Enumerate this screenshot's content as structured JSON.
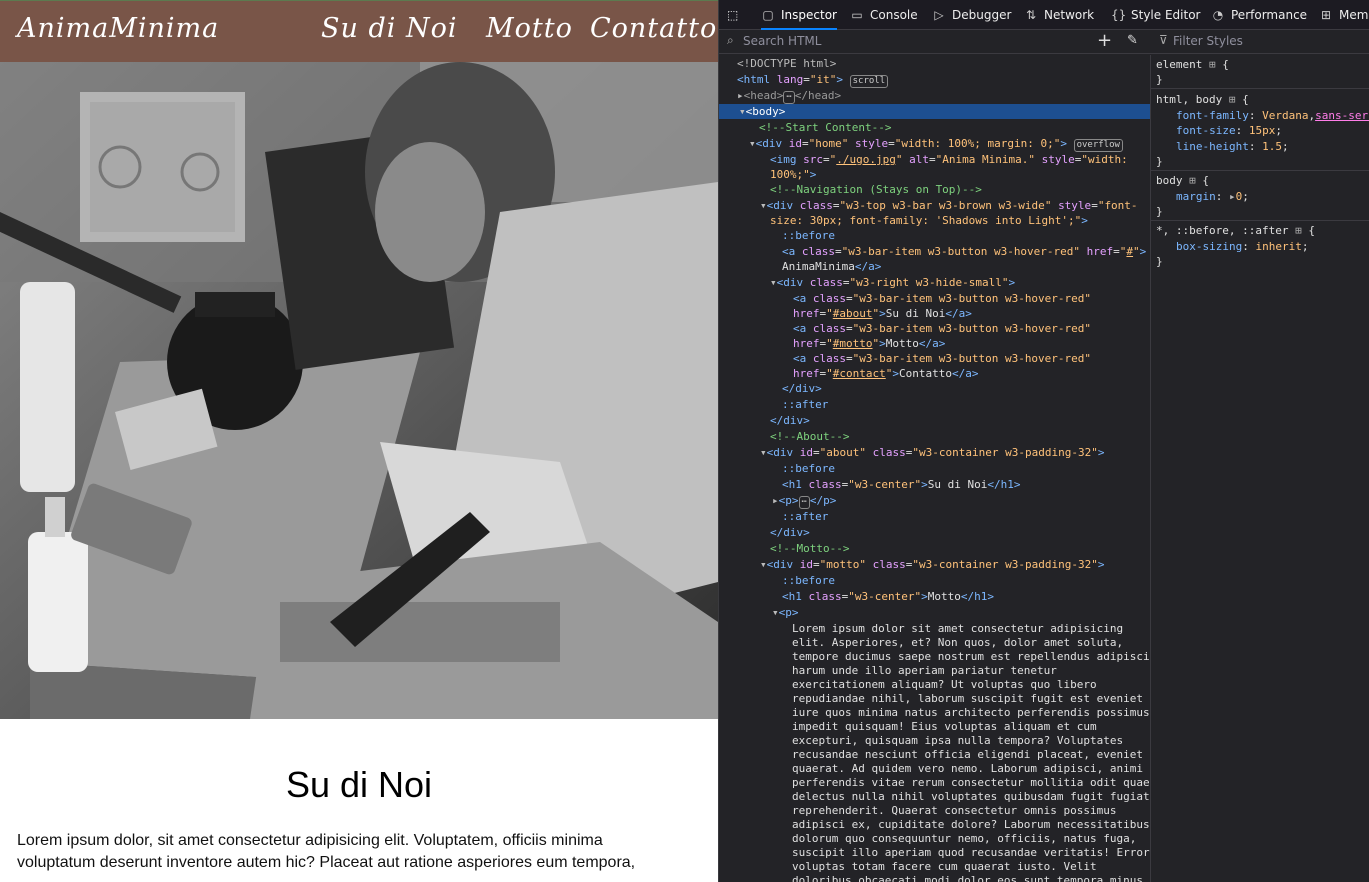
{
  "site": {
    "nav": {
      "brand": "AnimaMinima",
      "items": [
        "Su di Noi",
        "Motto",
        "Contatto"
      ]
    },
    "hero_alt": "Anima Minima.",
    "about": {
      "title": "Su di Noi",
      "text_line1": "Lorem ipsum dolor, sit amet consectetur adipisicing elit. Voluptatem, officiis minima",
      "text_line2": "voluptatum deserunt inventore autem hic? Placeat aut ratione asperiores eum tempora,"
    }
  },
  "devtools": {
    "tabs": [
      {
        "label": "Inspector",
        "icon": "inspector-icon"
      },
      {
        "label": "Console",
        "icon": "console-icon"
      },
      {
        "label": "Debugger",
        "icon": "debugger-icon"
      },
      {
        "label": "Network",
        "icon": "network-icon"
      },
      {
        "label": "Style Editor",
        "icon": "style-editor-icon"
      },
      {
        "label": "Performance",
        "icon": "performance-icon"
      },
      {
        "label": "Memo",
        "icon": "memory-icon"
      }
    ],
    "search_placeholder": "Search HTML",
    "filter_placeholder": "Filter Styles",
    "tree": {
      "doctype": "<!DOCTYPE html>",
      "html_lang": "it",
      "badge_scroll": "scroll",
      "badge_overflow": "overflow",
      "comment_start": "<!--Start Content-->",
      "home_style": "width: 100%; margin: 0;",
      "img_src": "./ugo.jpg",
      "img_alt": "Anima Minima.",
      "img_style_1": "width:",
      "img_style_2": "100%;",
      "comment_nav": "<!--Navigation (Stays on Top)-->",
      "top_class": "w3-top w3-bar w3-brown w3-wide",
      "top_style_1": "font-",
      "top_style_2": "size: 30px; font-family: 'Shadows into Light';",
      "before": "::before",
      "after": "::after",
      "bar_class": "w3-bar-item w3-button w3-hover-red",
      "brand_href": "#",
      "brand_text": "AnimaMinima",
      "right_class": "w3-right w3-hide-small",
      "link1_href": "#about",
      "link1_text": "Su di Noi",
      "link2_href": "#motto",
      "link2_text": "Motto",
      "link3_href": "#contact",
      "link3_text": "Contatto",
      "comment_about": "<!--About-->",
      "about_id": "about",
      "container_class": "w3-container w3-padding-32",
      "h1_class": "w3-center",
      "about_h1": "Su di Noi",
      "comment_motto": "<!--Motto-->",
      "motto_id": "motto",
      "motto_h1": "Motto",
      "motto_text": [
        "Lorem ipsum dolor sit amet consectetur adipisicing",
        "elit. Asperiores, et? Non quos, dolor amet soluta,",
        "tempore ducimus saepe nostrum est repellendus adipisci",
        "harum unde illo aperiam pariatur tenetur",
        "exercitationem aliquam? Ut voluptas quo libero",
        "repudiandae nihil, laborum suscipit fugit est eveniet",
        "iure quos minima natus architecto perferendis possimus",
        "impedit quisquam! Eius voluptas aliquam et cum",
        "excepturi, quisquam ipsa nulla tempora? Voluptates",
        "recusandae nesciunt officia eligendi placeat, eveniet",
        "quaerat. Ad quidem vero nemo. Laborum adipisci, animi",
        "perferendis vitae rerum consectetur mollitia odit quae",
        "delectus nulla nihil voluptates quibusdam fugit fugiat",
        "reprehenderit. Quaerat consectetur omnis possimus",
        "adipisci ex, cupiditate dolore? Laborum necessitatibus",
        "dolorum quo consequuntur nemo, officiis, natus fuga,",
        "suscipit illo aperiam quod recusandae veritatis! Error",
        "voluptas totam facere cum quaerat iusto. Velit",
        "doloribus obcaecati modi dolor eos sunt tempora minus,"
      ]
    },
    "rules": {
      "element_selector": "element",
      "htmlbody_selector": "html, body",
      "font_family_prop": "font-family",
      "font_family_val1": "Verdana",
      "font_family_val2": "sans-serif",
      "font_size_prop": "font-size",
      "font_size_val": "15px",
      "line_height_prop": "line-height",
      "line_height_val": "1.5",
      "body_selector": "body",
      "margin_prop": "margin",
      "margin_val": "0",
      "universal_selector": "*, ::before, ::after",
      "box_sizing_prop": "box-sizing",
      "box_sizing_val": "inherit"
    }
  }
}
